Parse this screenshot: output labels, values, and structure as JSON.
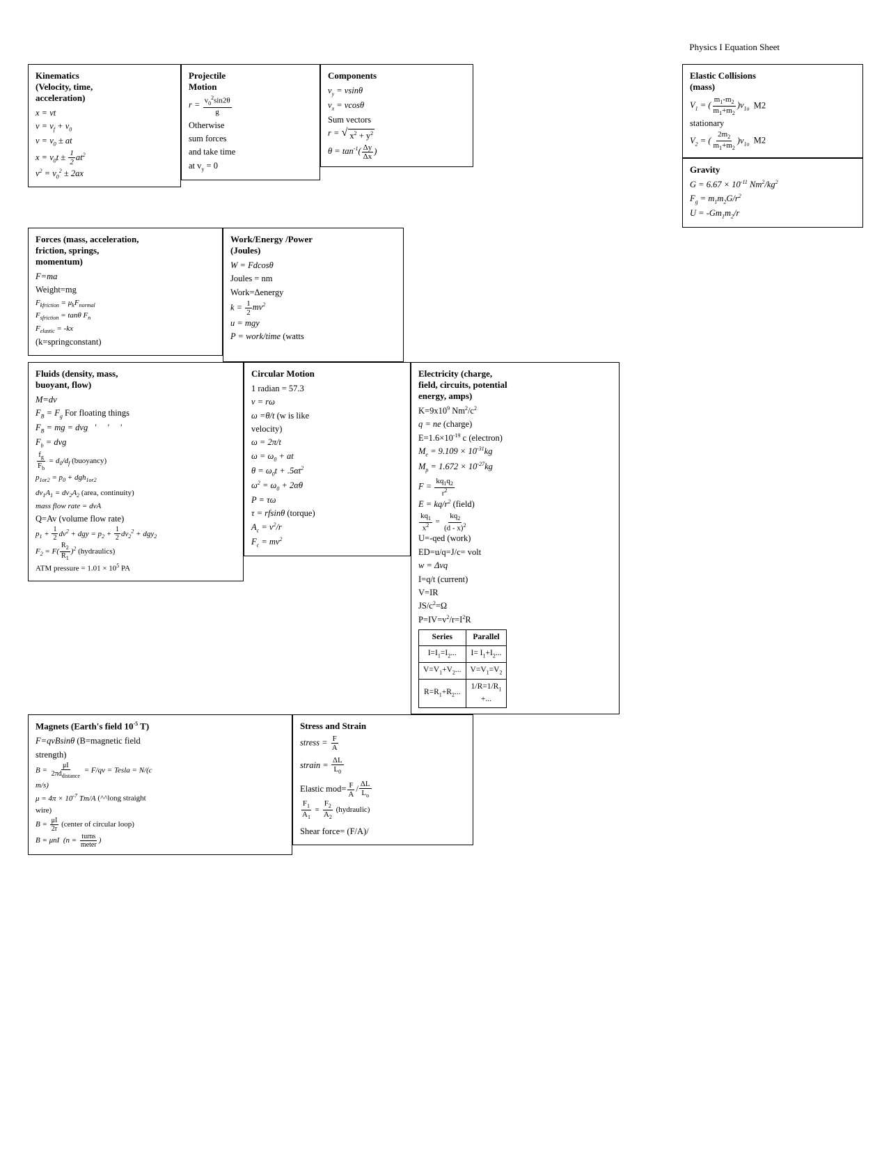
{
  "page": {
    "title": "Physics I Equation Sheet"
  },
  "row1": {
    "kinematics": {
      "title": "Kinematics (Velocity, time, acceleration)",
      "equations": [
        "x = vt",
        "v = v_f + v_0",
        "v = v_0 ± at",
        "x = v₀t ± ½at²",
        "v² = v₀² ± 2ax"
      ]
    },
    "projectile": {
      "title": "Projectile Motion",
      "eq1": "r = v₀²sin2θ / g",
      "note": "Otherwise sum forces and take time at v_y = 0"
    },
    "components": {
      "title": "Components",
      "equations": [
        "v_y = vsinθ",
        "v_x = vcosθ",
        "Sum vectors",
        "r = √(x² + y²)",
        "θ = tan⁻¹(Δy/Δx)"
      ]
    }
  },
  "row2_right_top": {
    "elastic": {
      "title": "Elastic Collisions (mass)",
      "eq1": "V₁ = ((m₁-m₂)/(m₁+m₂))v₁₀  M2 stationary",
      "eq2": "V₂ = ((2m₂)/(m₁+m₂))v₁₀  M2"
    },
    "gravity": {
      "title": "Gravity",
      "equations": [
        "G = 6.67 × 10⁻¹¹ Nm²/kg²",
        "F_g = m₁m₂G/r²",
        "U = -Gm₁m₂/r"
      ]
    }
  },
  "row2": {
    "forces": {
      "title": "Forces (mass, acceleration, friction, springs, momentum)",
      "equations": [
        "F=ma",
        "Weight=mg",
        "F_kfriction = μ_k F_normal",
        "F_sfriction = tanθ F_n",
        "F_elastic = -kx",
        "(k=springconstant)"
      ]
    },
    "work": {
      "title": "Work/Energy /Power (Joules)",
      "equations": [
        "W = Fdcosθ",
        "Joules = nm",
        "Work=Δenergy",
        "k = ½mv²",
        "u = mgy",
        "P = work/time (watts"
      ]
    }
  },
  "row3": {
    "fluids": {
      "title": "Fluids (density, mass, buoyant, flow)",
      "equations": [
        "M=dv",
        "F_B = F_g  For floating things",
        "F_B = mg = dvg",
        "F_b = dvg",
        "f_g/F_b = d₀/d_f (buoyancy)",
        "p₁or₂ = p₀ + dgh₁or₂",
        "dv₁A₁ = dv₂A₂ (area, continuity)",
        "mass flow rate = dvA",
        "Q=Av (volume flow rate)",
        "p₁ + ½dv² + dgy = p₂ + ½dv₂² + dgy₂",
        "F₂ = F(R₂/R₁)² (hydraulics)",
        "ATM pressure = 1.01 × 10⁵ PA"
      ]
    },
    "circular": {
      "title": "Circular Motion",
      "equations": [
        "1 radian = 57.3",
        "v = rω",
        "ω =θ/t (w is like velocity)",
        "ω = 2π/t",
        "ω = ω₀ + at",
        "θ = ω₀t + .5αt²",
        "ω² = ω₀ + 2αθ",
        "P = τω",
        "τ = rfsinθ (torque)",
        "A_c = v²/r",
        "F_c = mv²"
      ]
    },
    "electricity": {
      "title": "Electricity (charge, field, circuits, potential energy, amps)",
      "equations": [
        "K=9x10⁹ Nm²/c²",
        "q = ne (charge)",
        "E=1.6×10⁻¹⁹ c (electron)",
        "M_e = 9.109 × 10⁻³¹kg",
        "M_p = 1.672 × 10⁻²⁷kg",
        "F = kq₁q₂/r²",
        "E = kq/r² (field)",
        "kq₁/x² = kq₂/(d-x)²",
        "U=-qed (work)",
        "ED=u/q=J/c= volt",
        "w = Δvq",
        "I=q/t (current)",
        "V=IR",
        "JS/c²=Ω",
        "P=IV=v²/r=I²R"
      ],
      "table": {
        "headers": [
          "Series",
          "Parallel"
        ],
        "rows": [
          [
            "I=I₁=I₂...",
            "I= I₁+I₂..."
          ],
          [
            "V=V₁+V₂...",
            "V=V₁=V₂"
          ],
          [
            "R=R₁+R₂...",
            "1/R=1/R₁+..."
          ]
        ]
      }
    }
  },
  "row4": {
    "magnets": {
      "title": "Magnets (Earth's field 10⁻⁵ T)",
      "equations": [
        "F=qvBsinθ (B=magnetic field strength)",
        "B = μI/2πd_distance = F/qv = Tesla = N/(c m/s)",
        "μ = 4π × 10⁻⁷ Tm/A (^^long straight wire)",
        "B = μI/2r (center of circular loop)",
        "B = μnI (n = turns/meter)"
      ]
    },
    "stress": {
      "title": "Stress and Strain",
      "equations": [
        "stress = F/A",
        "strain = ΔL/L₀",
        "Elastic mod= F/A / ΔL/L₀",
        "F₁/A₁ = F₂/A₂ (hydraulic)",
        "Shear force= (F/A)/"
      ]
    }
  }
}
